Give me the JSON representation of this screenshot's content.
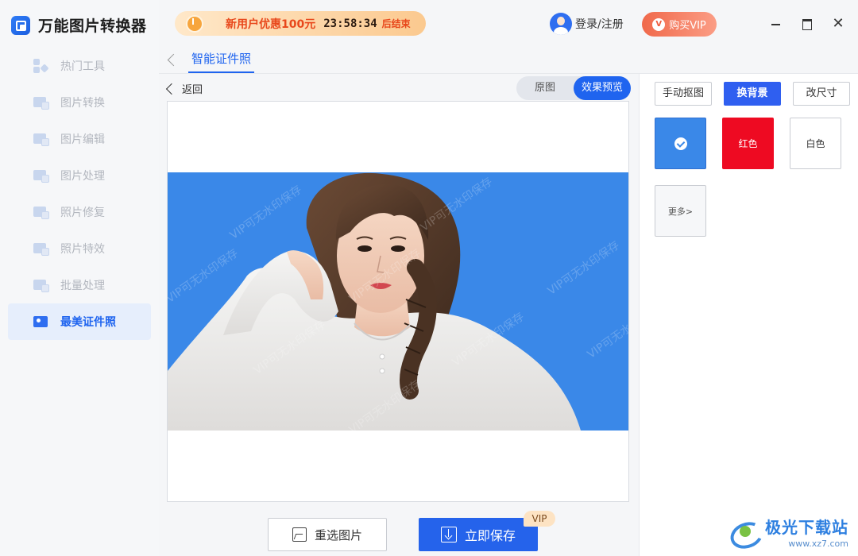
{
  "app": {
    "title": "万能图片转换器"
  },
  "sidebar": {
    "items": [
      {
        "label": "热门工具",
        "icon": "hot-tools-icon"
      },
      {
        "label": "图片转换",
        "icon": "image-convert-icon"
      },
      {
        "label": "图片编辑",
        "icon": "image-edit-icon"
      },
      {
        "label": "图片处理",
        "icon": "image-process-icon"
      },
      {
        "label": "照片修复",
        "icon": "photo-repair-icon"
      },
      {
        "label": "照片特效",
        "icon": "photo-effect-icon"
      },
      {
        "label": "批量处理",
        "icon": "batch-process-icon"
      },
      {
        "label": "最美证件照",
        "icon": "id-photo-icon",
        "active": true
      }
    ]
  },
  "header": {
    "promo_text": "新用户优惠100元",
    "promo_timer": "23:58:34",
    "promo_end": "后结束",
    "login_label": "登录/注册",
    "vip_label": "购买VIP"
  },
  "page_tab": {
    "label": "智能证件照"
  },
  "preview": {
    "back_label": "返回",
    "toggle": {
      "original": "原图",
      "effect": "效果预览",
      "selected": "effect"
    },
    "watermark_text": "VIP可无水印保存",
    "background_color": "#3a88e8"
  },
  "actions": {
    "reselect_label": "重选图片",
    "save_label": "立即保存",
    "vip_tag": "VIP"
  },
  "right_panel": {
    "tabs": [
      {
        "label": "手动抠图"
      },
      {
        "label": "换背景",
        "active": true
      },
      {
        "label": "改尺寸"
      }
    ],
    "swatches": [
      {
        "color": "#3a88e8",
        "label": "",
        "selected": true
      },
      {
        "color": "#ee0a22",
        "label": "红色"
      },
      {
        "color": "#ffffff",
        "label": "白色"
      }
    ],
    "more_label": "更多>"
  },
  "brand": {
    "name": "极光下载站",
    "url": "www.xz7.com"
  }
}
